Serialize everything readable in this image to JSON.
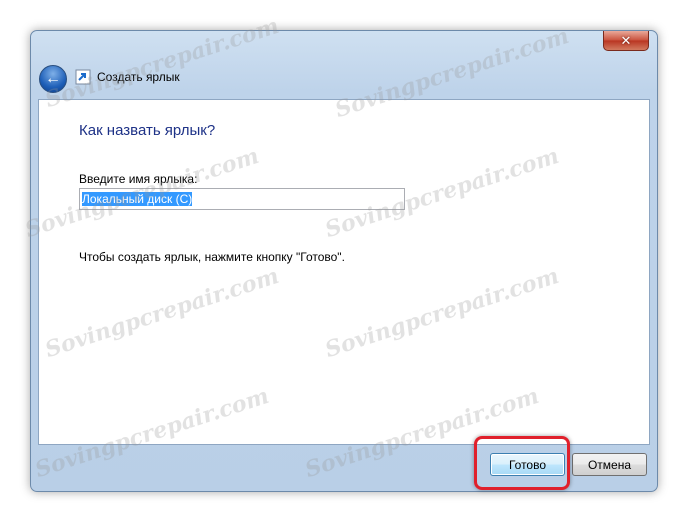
{
  "window": {
    "title": "Создать ярлык",
    "close_label": "✕"
  },
  "wizard": {
    "heading": "Как назвать ярлык?",
    "field_label": "Введите имя ярлыка:",
    "field_value": "Локальный диск (C)",
    "hint": "Чтобы создать ярлык, нажмите кнопку \"Готово\"."
  },
  "buttons": {
    "done": "Готово",
    "cancel": "Отмена"
  },
  "watermark": "Sovingpcrepair.com",
  "colors": {
    "heading": "#1e3287",
    "highlight": "#e0202c",
    "selection": "#3399ff"
  },
  "icons": {
    "back": "back-arrow-icon",
    "shortcut": "shortcut-icon",
    "close": "close-icon"
  }
}
